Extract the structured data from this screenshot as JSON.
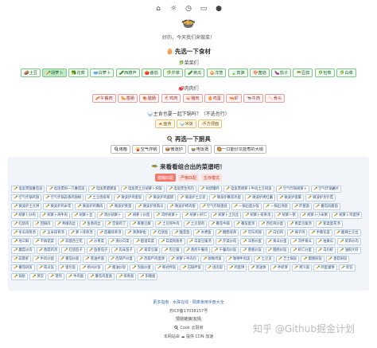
{
  "top_icons": [
    "home-icon",
    "sun-icon",
    "clock-icon",
    "bookmark-icon",
    "github-icon"
  ],
  "logo": "🍲",
  "subtitle": "好的，今天我们来做菜！",
  "step1": {
    "title": "先选一下食材",
    "veg_label": "🥬菜菜们",
    "veg": [
      "🥔土豆",
      "🥕胡萝卜",
      "🥦花菜",
      "🥣白萝卜",
      "🥒西葫芦",
      "🍅番茄",
      "🥬芹菜",
      "🥒黄瓜",
      "🧅洋葱",
      "🍃莴笋",
      "🍄菌菇",
      "🍆茄子",
      "🥗豆腐",
      "🥬包菜",
      "🥬白菜"
    ],
    "meat_label": "🥩肉肉们",
    "meat": [
      "🥓午餐肉",
      "🌭香肠",
      "🍖腊肠",
      "🐔鸡肉",
      "🐷猪肉",
      "🥚鸡蛋",
      "🦐虾",
      "🐄牛肉",
      "🦴骨头"
    ],
    "staple_label": "主食也要一起下锅吗？（不选也行）",
    "staple": [
      "🍝面食",
      "🍚米饭",
      "🍜方便面"
    ]
  },
  "step2": {
    "title": "再选一下厨具",
    "tools": [
      "🍳烤箱",
      "🍟空气炸锅",
      "📦微波炉",
      "🍲电饭煲",
      "🥘一口能炒又能煮的大锅"
    ]
  },
  "step3": {
    "title": "来看看组合出的菜谱吧！",
    "tabs": [
      "模糊匹配",
      "严格匹配",
      "生存模式"
    ]
  },
  "recipes": [
    "电饭煲版番茄饭",
    "电饭煲焖一只番茄饭",
    "电饭煲腊肠饭",
    "电饭煲土豆胡萝卜焖饭",
    "电饭煲生煎包",
    "焖烧罐鸡",
    "电饭煲胡萝卜牛肉土豆焖饭",
    "空气炸锅胡萝卜",
    "空气炸锅薯片",
    "空气炸锅鸡翅",
    "空气炸锅蒜香鸡翅根",
    "土豆烧排骨",
    "微波炉鸡蛋饭",
    "微波炉鸡蛋糕",
    "微波炉土豆泥",
    "微波炉番茄鸡蛋",
    "微波炉烤红薯",
    "微波炉蛋羹",
    "微波炉金针菇",
    "微波炉土豆饼",
    "微波炉鸡米花",
    "微波炉鸡胸肉",
    "微波炉蒸蛋",
    "微波炉蒸南瓜",
    "微波炉烤鸡翅",
    "空气炸锅蛋挞",
    "一锅出蛋炒饭",
    "一锅出汤面",
    "炸酱面",
    "番茄肉酱面",
    "胡萝卜炒肉",
    "胡萝卜炖牛肉",
    "胡萝卜丝",
    "清炒胡萝卜",
    "胡萝卜炒蛋",
    "凉拌胡萝卜",
    "胡萝卜虾仁",
    "胡萝卜土豆丝",
    "胡萝卜排骨汤",
    "胡萝卜粥",
    "胡萝卜小米粥",
    "胡萝卜鸡蛋饼",
    "红烧肉",
    "回锅肉",
    "青椒肉丝",
    "鱼香肉丝",
    "宫保鸡丁",
    "麻婆豆腐",
    "土豆炖牛肉",
    "土豆烧鸡",
    "番茄牛腩",
    "番茄蛋汤",
    "西红柿炒蛋",
    "青菜豆腐汤",
    "紫菜蛋花汤",
    "冬瓜排骨汤",
    "玉米排骨汤",
    "萝卜排骨汤",
    "莲藕排骨汤",
    "清蒸鲈鱼",
    "红烧鱼",
    "酸菜鱼",
    "水煮鱼",
    "糖醋排骨",
    "可乐鸡翅",
    "白切鸡",
    "辣子鸡",
    "手撕包菜",
    "酸辣土豆丝",
    "地三鲜",
    "干锅花菜",
    "蒜蓉西兰花",
    "炒青菜",
    "清炒白菜",
    "醋溜白菜",
    "白菜炖粉条",
    "白菜豆腐汤",
    "芹菜炒肉",
    "洋葱炒蛋",
    "黄瓜炒蛋",
    "凉拌黄瓜",
    "拍黄瓜",
    "莴笋炒肉",
    "蘑菇炒肉",
    "香菇鸡汤",
    "红烧茄子",
    "鱼香茄子",
    "肉末茄子",
    "家常豆腐",
    "煎豆腐",
    "香煎午餐肉",
    "午餐肉炒饭",
    "香肠炒饭",
    "腊肠炒饭",
    "虾仁炒蛋",
    "白灼虾",
    "油焖大虾",
    "蒜蓉虾",
    "牛肉炒面",
    "番茄炒面",
    "葱油拌面",
    "西葫芦炒蛋",
    "西葫芦鸡蛋饼",
    "胡萝卜牛肉包",
    "咖喱鸡饭",
    "咖喱牛肉饭",
    "土豆泥",
    "芝士焗饭",
    "腊肠焖饭",
    "香菇焖饭",
    "番茄焖饭",
    "南瓜饭",
    "蛋包饭",
    "扬州炒饭",
    "酱油炒饭",
    "泡面炒蛋",
    "韩式拌饭",
    "石锅拌饭",
    "卤肉饭",
    "鸡蛋饼",
    "葱油饼",
    "手抓饼",
    "烤冷面",
    "鸡蛋灌饼",
    "煎饺",
    "锅贴",
    "蒸饺",
    "馄饨",
    "牛肉面",
    "番茄鸡蛋面",
    "排骨面",
    "阳春面"
  ],
  "footer": {
    "links": [
      "更多指南",
      "水珠在线",
      "隔离食用手册大全"
    ],
    "icp": "苏ICP备17038157号",
    "badge": "赞助链接/友情",
    "cook": "Cook",
    "cook_suffix": "云厨房",
    "hosted": "本网站由",
    "cdn": "提供 CDN 加速"
  },
  "watermark": "知乎 @Github掘金计划"
}
